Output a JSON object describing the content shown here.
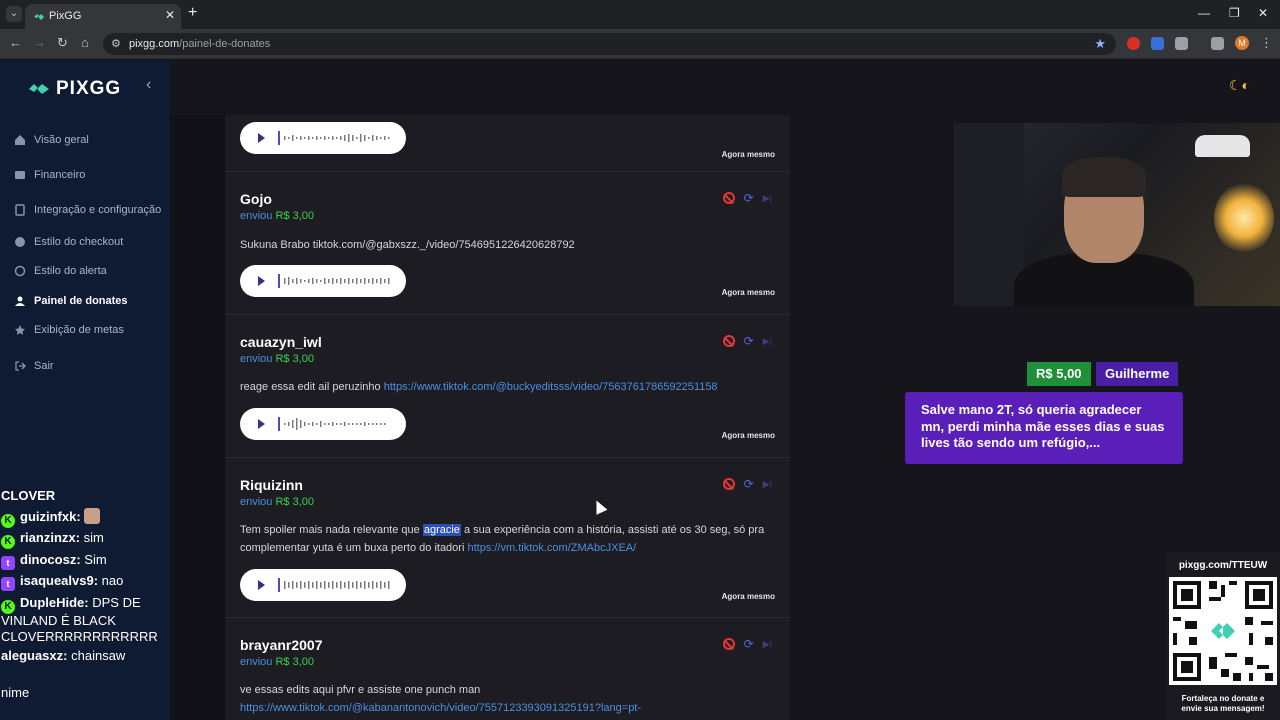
{
  "browser": {
    "tab_title": "PixGG",
    "url_host": "pixgg.com",
    "url_path": "/painel-de-donates",
    "profile_initial": "M"
  },
  "sidebar": {
    "brand": "PIXGG",
    "items": [
      {
        "label": "Visão geral",
        "icon": "home-icon"
      },
      {
        "label": "Financeiro",
        "icon": "wallet-icon"
      },
      {
        "label": "Integração e configuração",
        "icon": "settings-icon"
      },
      {
        "label": "Estilo do checkout",
        "icon": "palette-icon"
      },
      {
        "label": "Estilo do alerta",
        "icon": "brush-icon"
      },
      {
        "label": "Painel de donates",
        "icon": "dashboard-icon"
      },
      {
        "label": "Exibição de metas",
        "icon": "star-icon"
      },
      {
        "label": "Sair",
        "icon": "logout-icon"
      }
    ],
    "active": "Painel de donates"
  },
  "chat": [
    {
      "user": "CLOVER",
      "message": "",
      "badge": ""
    },
    {
      "user": "guizinfxk:",
      "message": "",
      "badge": "kick"
    },
    {
      "user": "rianzinzx:",
      "message": "sim",
      "badge": "kick"
    },
    {
      "user": "dinocosz:",
      "message": "Sim",
      "badge": "twitch"
    },
    {
      "user": "isaquealvs9:",
      "message": "nao",
      "badge": "twitch"
    },
    {
      "user": "DupleHide:",
      "message": "DPS DE",
      "badge": "kick"
    },
    {
      "user": "",
      "message": "VINLAND É BLACK",
      "badge": ""
    },
    {
      "user": "",
      "message": "CLOVERRRRRRRRRRRR",
      "badge": ""
    },
    {
      "user": "aleguasxz:",
      "message": "chainsaw",
      "badge": ""
    },
    {
      "user": "",
      "message": "nime",
      "badge": ""
    }
  ],
  "donations": [
    {
      "name": "",
      "sent_label": "",
      "amount": "",
      "message": "",
      "link": "",
      "time": "Agora mesmo"
    },
    {
      "name": "Gojo",
      "sent_label": "enviou",
      "amount": "R$ 3,00",
      "message": "Sukuna Brabo tiktok.com/@gabxszz._/video/7546951226420628792",
      "link": "",
      "time": "Agora mesmo"
    },
    {
      "name": "cauazyn_iwl",
      "sent_label": "enviou",
      "amount": "R$ 3,00",
      "message": "reage essa edit ail peruzinho",
      "link": "https://www.tiktok.com/@buckyeditsss/video/7563761786592251158",
      "time": "Agora mesmo"
    },
    {
      "name": "Riquizinn",
      "sent_label": "enviou",
      "amount": "R$ 3,00",
      "message_pre": "Tem spoiler mais nada relevante que",
      "message_hl": "agracie",
      "message_post": "a sua experiência com a história, assisti até os 30 seg, só pra complementar yuta é um buxa perto do itadori",
      "link": "https://vm.tiktok.com/ZMAbcJXEA/",
      "time": "Agora mesmo"
    },
    {
      "name": "brayanr2007",
      "sent_label": "enviou",
      "amount": "R$ 3,00",
      "message": "ve essas edits aqui pfvr e assiste one punch man",
      "link": "https://www.tiktok.com/@kabanantonovich/video/7557123393091325191?lang=pt-",
      "time": ""
    }
  ],
  "alert": {
    "amount": "R$ 5,00",
    "name": "Guilherme",
    "message": "Salve mano 2T, só queria agradecer mn, perdi minha mãe esses dias e suas lives tão sendo um refúgio,..."
  },
  "qr": {
    "url": "pixgg.com/TTEUW",
    "caption_line1": "Fortaleça no donate e",
    "caption_line2": "envie sua mensagem!"
  },
  "colors": {
    "sidebar_bg": "#0f1a33",
    "accent_green": "#3ccf4e",
    "accent_blue": "#4a90e2",
    "alert_purple": "#5a1fb8"
  }
}
